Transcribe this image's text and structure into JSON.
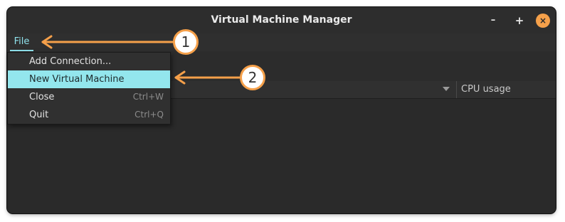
{
  "window": {
    "title": "Virtual Machine Manager"
  },
  "window_buttons": {
    "minimize": "–",
    "maximize": "+",
    "close": "×"
  },
  "menubar": {
    "file_label": "File"
  },
  "columns": {
    "cpu_usage": "CPU usage"
  },
  "file_menu": {
    "items": [
      {
        "label": "Add Connection...",
        "accel": ""
      },
      {
        "label": "New Virtual Machine",
        "accel": ""
      },
      {
        "label": "Close",
        "accel": "Ctrl+W"
      },
      {
        "label": "Quit",
        "accel": "Ctrl+Q"
      }
    ]
  },
  "annotations": {
    "step1": "1",
    "step2": "2"
  },
  "colors": {
    "accent": "#8fe2ec",
    "highlight": "#93e6ed",
    "callout": "#f5a04a"
  }
}
